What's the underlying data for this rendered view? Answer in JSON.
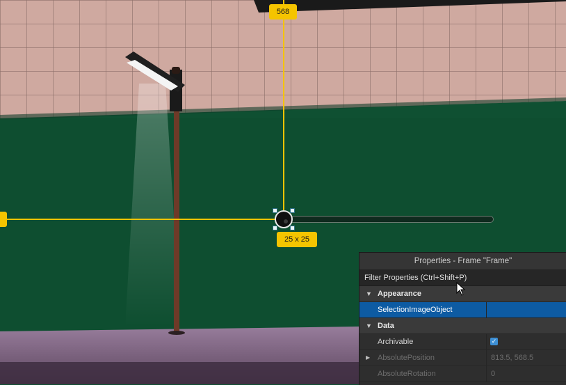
{
  "guides": {
    "y_label": "568",
    "x_label": "",
    "size_label": "25 x 25"
  },
  "slider": {
    "value_fraction": 0.0
  },
  "properties_panel": {
    "title": "Properties - Frame \"Frame\"",
    "filter_placeholder": "Filter Properties (Ctrl+Shift+P)",
    "sections": [
      {
        "name": "Appearance",
        "rows": [
          {
            "name": "SelectionImageObject",
            "value": "",
            "selected": true
          }
        ]
      },
      {
        "name": "Data",
        "rows": [
          {
            "name": "Archivable",
            "value": "checked",
            "type": "checkbox"
          },
          {
            "name": "AbsolutePosition",
            "value": "813.5, 568.5",
            "disabled": true,
            "expandable": true
          },
          {
            "name": "AbsoluteRotation",
            "value": "0",
            "disabled": true
          }
        ]
      }
    ]
  },
  "icons": [
    "checkmark-icon",
    "collapse-triangle-icon",
    "expand-triangle-icon",
    "mouse-pointer-icon"
  ],
  "colors": {
    "guide": "#f5c400",
    "wall": "#0f5032",
    "selection": "#0d5ba3",
    "checkbox": "#3d8fd4"
  }
}
